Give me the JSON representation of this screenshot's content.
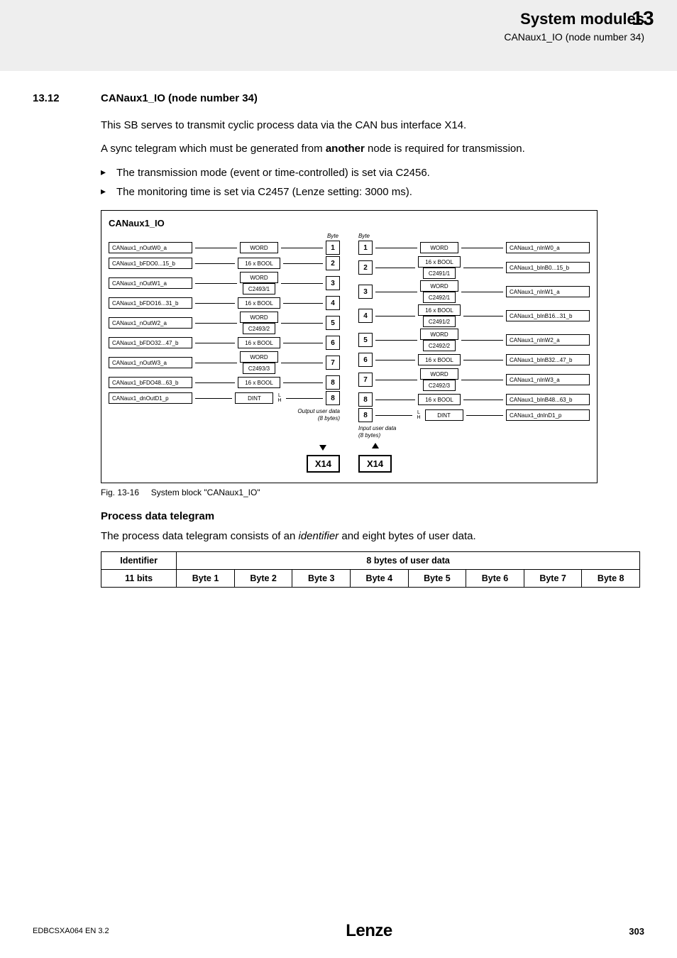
{
  "header": {
    "title": "System modules",
    "subtitle": "CANaux1_IO (node number 34)",
    "section_number": "13"
  },
  "section": {
    "number": "13.12",
    "title": "CANaux1_IO (node number 34)"
  },
  "paragraphs": {
    "p1": "This SB serves to transmit cyclic process data via the CAN bus interface X14.",
    "p2_a": "A sync telegram which must be generated from ",
    "p2_b": "another",
    "p2_c": " node is required for transmission.",
    "b1": "The transmission mode (event or time-controlled) is set via C2456.",
    "b2": "The monitoring time is set via C2457 (Lenze setting: 3000 ms)."
  },
  "diagram": {
    "title": "CANaux1_IO",
    "byte_label": "Byte",
    "out_labels": [
      "CANaux1_nOutW0_a",
      "CANaux1_bFDO0...15_b",
      "CANaux1_nOutW1_a",
      "CANaux1_bFDO16...31_b",
      "CANaux1_nOutW2_a",
      "CANaux1_bFDO32...47_b",
      "CANaux1_nOutW3_a",
      "CANaux1_bFDO48...63_b",
      "CANaux1_dnOutD1_p"
    ],
    "in_labels": [
      "CANaux1_nInW0_a",
      "CANaux1_bInB0...15_b",
      "CANaux1_nInW1_a",
      "CANaux1_bInB16...31_b",
      "CANaux1_nInW2_a",
      "CANaux1_bInB32...47_b",
      "CANaux1_nInW3_a",
      "CANaux1_bInB48...63_b",
      "CANaux1_dnInD1_p"
    ],
    "type_word": "WORD",
    "type_bool": "16 x BOOL",
    "type_dint": "DINT",
    "codes_out": [
      "C2493/1",
      "C2493/2",
      "C2493/3"
    ],
    "codes_in": [
      "C2491/1",
      "C2492/1",
      "C2491/2",
      "C2492/2",
      "C2492/3"
    ],
    "bytes": [
      "1",
      "2",
      "3",
      "4",
      "5",
      "6",
      "7",
      "8"
    ],
    "hl_l": "L",
    "hl_h": "H",
    "out_data": "Output user data",
    "in_data": "Input user data",
    "bytes8": "(8 bytes)",
    "x14": "X14"
  },
  "fig_caption": {
    "num": "Fig. 13-16",
    "text": "System block \"CANaux1_IO\""
  },
  "pdt": {
    "heading": "Process data telegram",
    "intro_a": "The process data telegram consists of an ",
    "intro_b": "identifier",
    "intro_c": " and eight bytes of user data.",
    "col_identifier": "Identifier",
    "col_userdata": "8 bytes of user data",
    "bits": "11 bits",
    "bytes": [
      "Byte 1",
      "Byte 2",
      "Byte 3",
      "Byte 4",
      "Byte 5",
      "Byte 6",
      "Byte 7",
      "Byte 8"
    ]
  },
  "footer": {
    "doc": "EDBCSXA064 EN 3.2",
    "brand": "Lenze",
    "page": "303"
  }
}
